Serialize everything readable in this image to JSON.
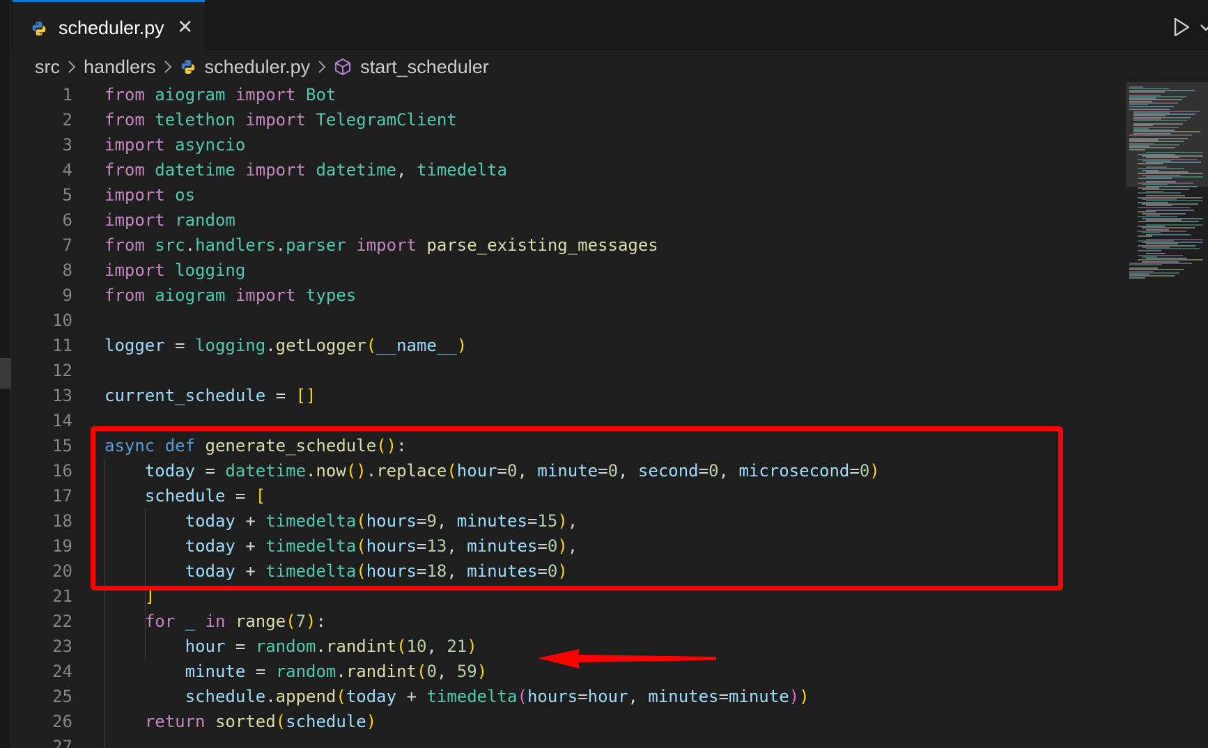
{
  "tab": {
    "label": "scheduler.py",
    "close_glyph": "✕",
    "icon": "python-icon"
  },
  "breadcrumb": {
    "items": [
      "src",
      "handlers",
      "scheduler.py",
      "start_scheduler"
    ]
  },
  "colors": {
    "accent": "#0078d4",
    "annotation": "#ff0000",
    "background": "#1e1e1e"
  },
  "editor": {
    "line_numbers": [
      "1",
      "2",
      "3",
      "4",
      "5",
      "6",
      "7",
      "8",
      "9",
      "10",
      "11",
      "12",
      "13",
      "14",
      "15",
      "16",
      "17",
      "18",
      "19",
      "20",
      "21",
      "22",
      "23",
      "24",
      "25",
      "26",
      "27"
    ],
    "lines": [
      "from aiogram import Bot",
      "from telethon import TelegramClient",
      "import asyncio",
      "from datetime import datetime, timedelta",
      "import os",
      "import random",
      "from src.handlers.parser import parse_existing_messages",
      "import logging",
      "from aiogram import types",
      "",
      "logger = logging.getLogger(__name__)",
      "",
      "current_schedule = []",
      "",
      "async def generate_schedule():",
      "    today = datetime.now().replace(hour=0, minute=0, second=0, microsecond=0)",
      "    schedule = [",
      "        today + timedelta(hours=9, minutes=15),",
      "        today + timedelta(hours=13, minutes=0),",
      "        today + timedelta(hours=18, minutes=0)",
      "    ]",
      "    for _ in range(7):",
      "        hour = random.randint(10, 21)",
      "        minute = random.randint(0, 59)",
      "        schedule.append(today + timedelta(hours=hour, minutes=minute))",
      "    return sorted(schedule)",
      ""
    ]
  },
  "annotations": {
    "box": "red-rectangle",
    "arrow": "red-arrow"
  }
}
